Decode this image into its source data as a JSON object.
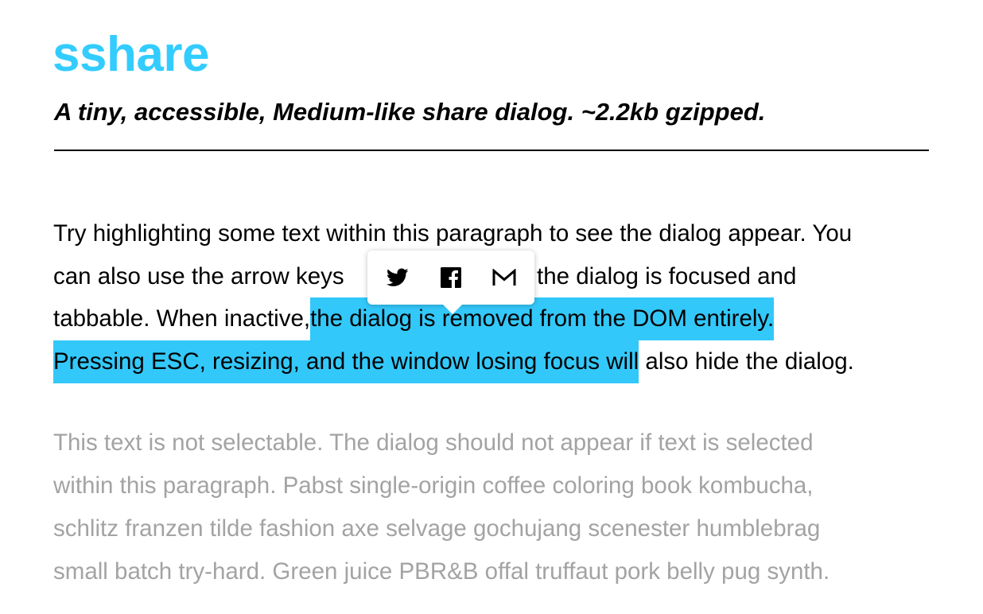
{
  "header": {
    "title": "sshare",
    "subtitle": "A tiny, accessible, Medium-like share dialog. ~2.2kb gzipped."
  },
  "selectable_paragraph": {
    "line1": "Try highlighting some text within this paragraph to see the dialog appear. You",
    "line2": "can also use the arrow keys",
    "line2_end": "the dialog is focused and",
    "line3_plain": "tabbable. When inactive,",
    "line3_selected": " the dialog is removed from the DOM entirely. ",
    "line4_selected": "Pressing ESC, resizing, and the window losing focus will",
    "line4_plain": " also hide the dialog."
  },
  "non_selectable_paragraph": {
    "line1": "This text is not selectable. The dialog should not appear if text is selected",
    "line2": "within this paragraph. Pabst single-origin coffee coloring book kombucha,",
    "line3": "schlitz franzen tilde fashion axe selvage gochujang scenester humblebrag",
    "line4": "small batch try-hard. Green juice PBR&B offal truffaut pork belly pug synth."
  },
  "share_dialog": {
    "buttons": [
      {
        "icon": "twitter-icon"
      },
      {
        "icon": "facebook-icon"
      },
      {
        "icon": "gmail-icon"
      }
    ]
  },
  "colors": {
    "accent": "#33ccff",
    "selection": "#33c8fa",
    "muted_text": "#a3a3a3"
  }
}
